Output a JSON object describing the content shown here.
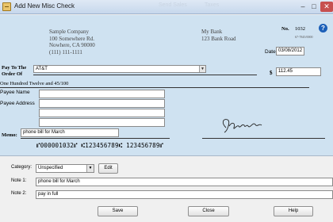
{
  "window": {
    "title": "Add New Misc Check",
    "ghost_tabs": [
      "Send Sales",
      "Taxes"
    ],
    "controls": [
      "–",
      "□",
      "✕"
    ]
  },
  "check": {
    "company_lines": [
      "Sample Company",
      "100 Somewhere Rd.",
      "Nowhere, CA 90000",
      "(111) 111-1111"
    ],
    "bank_lines": [
      "My Bank",
      "123 Bank Road"
    ],
    "number_label": "No.",
    "number": "1032",
    "routing_code": "67-7845/0000",
    "date_label": "Date",
    "date": "03/08/2012",
    "pay_to_label_1": "Pay To The",
    "pay_to_label_2": "Order Of",
    "payee": "AT&T",
    "dollar_sign": "$",
    "amount": "112.45",
    "amount_words": "One Hundred Twelve and 45/100",
    "payee_name_label": "Payee Name",
    "payee_address_label": "Payee Address",
    "memo_label": "Memo:",
    "memo": "phone bill for March",
    "micr": "⑈000001032⑈ ⑆123456789⑆ 123456789⑈"
  },
  "form": {
    "category_label": "Category:",
    "category_value": "Unspecified",
    "edit_label": "Edit",
    "note1_label": "Note 1:",
    "note1_value": "phone bill for March",
    "note2_label": "Note 2:",
    "note2_value": "pay in full"
  },
  "buttons": {
    "save": "Save",
    "close": "Close",
    "help": "Help"
  },
  "icons": {
    "help": "?"
  }
}
